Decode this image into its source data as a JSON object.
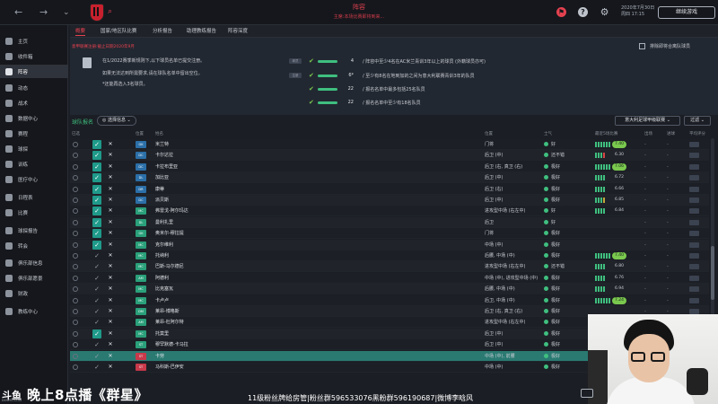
{
  "topbar": {
    "title": "阵容",
    "subtitle": "主席:本场比赛即将到来...",
    "date_line1": "2020年7月30日",
    "date_line2": "周四 17:15",
    "continue_label": "继续游戏"
  },
  "sidebar": {
    "items": [
      {
        "label": "主页"
      },
      {
        "label": "收件箱"
      },
      {
        "label": "阵容"
      },
      {
        "label": "动态"
      },
      {
        "label": "战术"
      },
      {
        "label": "数据中心"
      },
      {
        "label": "赛程"
      },
      {
        "label": "球探"
      },
      {
        "label": "训练"
      },
      {
        "label": "医疗中心"
      },
      {
        "label": "日程表"
      },
      {
        "label": "比赛"
      },
      {
        "label": "球探报告"
      },
      {
        "label": "转会"
      },
      {
        "label": "俱乐部信息"
      },
      {
        "label": "俱乐部愿景"
      },
      {
        "label": "财政"
      },
      {
        "label": "教练中心"
      }
    ],
    "active_index": 2
  },
  "tabs": [
    "概要",
    "国家/地区队比赛",
    "分析报告",
    "助理教练报告",
    "阵容深度"
  ],
  "info": {
    "note": "意甲联赛注册:截止日期2020年9月",
    "desc_lines": [
      "在1/2022赛季新规则下,以下球员名单已提交注册。",
      "如果无法达到所需要求,请在球队名单中留出空位。",
      "*还能再选入3名球员。"
    ],
    "rules": [
      {
        "tag": "球员",
        "check": "✔",
        "value": "4",
        "text": "/ 阵容中至少4名在AC米兰青训3年以上的球员 (外籍球员亦可)"
      },
      {
        "tag": "注册",
        "check": "✔",
        "value": "6*",
        "text": "/ 至少有8名在地到加的之间为意大利联赛青训3年的队员"
      },
      {
        "tag": "",
        "check": "✔",
        "value": "22",
        "text": "/ 报名名单中最多包括25名队员"
      },
      {
        "tag": "",
        "check": "✔",
        "value": "22",
        "text": "/ 报名名单中至少有18名队员"
      }
    ],
    "exclude_label": "排除即将合离队球员"
  },
  "controls": {
    "squad_title": "球队报名",
    "select_label": "◎ 选择信息 ⌄",
    "league_label": "意大利足球甲级联赛 ⌄",
    "filter_label": "过滤 ⌄"
  },
  "headers": {
    "select": "已选",
    "pos": "位置",
    "name": "姓名",
    "position": "位置",
    "morale": "士气",
    "form": "最近5场比赛",
    "rating": "平均评分",
    "apps": "出场",
    "goals": "进球",
    "avg": "平均评分"
  },
  "rows": [
    {
      "c1": true,
      "c2": true,
      "pos": "GK",
      "pos_color": "#2b6fa8",
      "name": "米兰特",
      "position": "门将",
      "morale": "好",
      "rating": "7.40",
      "hi": true,
      "form": "gggggg"
    },
    {
      "c1": true,
      "c2": true,
      "pos": "DC",
      "pos_color": "#2b6fa8",
      "name": "卡尔达拉",
      "position": "后卫 (中)",
      "morale": "还不错",
      "rating": "6.30",
      "hi": false,
      "form": "gggr"
    },
    {
      "c1": true,
      "c2": true,
      "pos": "DC",
      "pos_color": "#2b6fa8",
      "name": "卡拉布里亚",
      "position": "后卫 (右, 真卫 (右)",
      "morale": "极好",
      "rating": "7.06",
      "hi": true,
      "form": "gggggg"
    },
    {
      "c1": true,
      "c2": true,
      "pos": "DL",
      "pos_color": "#2b6fa8",
      "name": "加比亚",
      "position": "后卫 (中)",
      "morale": "极好",
      "rating": "6.72",
      "hi": false,
      "form": "gggg"
    },
    {
      "c1": true,
      "c2": true,
      "pos": "DR",
      "pos_color": "#2b6fa8",
      "name": "康蒂",
      "position": "后卫 (右)",
      "morale": "极好",
      "rating": "6.66",
      "hi": false,
      "form": "gggg"
    },
    {
      "c1": true,
      "c2": true,
      "pos": "DC",
      "pos_color": "#2b6fa8",
      "name": "派贝斯",
      "position": "后卫 (中)",
      "morale": "极好",
      "rating": "6.85",
      "hi": false,
      "form": "gggy"
    },
    {
      "c1": true,
      "c2": true,
      "pos": "MC",
      "pos_color": "#2aa07a",
      "name": "弗雷戈-阿尔玛达",
      "position": "进攻型中场 (右左中)",
      "morale": "好",
      "rating": "6.84",
      "hi": false,
      "form": "gggg"
    },
    {
      "c1": true,
      "c2": true,
      "pos": "DL",
      "pos_color": "#2aa07a",
      "name": "曼利扎里",
      "position": "后卫",
      "morale": "好",
      "rating": "",
      "hi": false,
      "form": ""
    },
    {
      "c1": true,
      "c2": true,
      "pos": "GK",
      "pos_color": "#2aa07a",
      "name": "奥米尔-穆拉提",
      "position": "门将",
      "morale": "极好",
      "rating": "",
      "hi": false,
      "form": ""
    },
    {
      "c1": true,
      "c2": true,
      "pos": "MC",
      "pos_color": "#2aa07a",
      "name": "克尔维利",
      "position": "中场 (中)",
      "morale": "极好",
      "rating": "",
      "hi": false,
      "form": ""
    },
    {
      "c1": false,
      "c2": true,
      "pos": "MC",
      "pos_color": "#2aa07a",
      "name": "托纳利",
      "position": "后腰, 中场 (中)",
      "morale": "极好",
      "rating": "7.40",
      "hi": true,
      "form": "gggggg"
    },
    {
      "c1": false,
      "c2": true,
      "pos": "MC",
      "pos_color": "#2aa07a",
      "name": "巴斯-马尔德尼",
      "position": "进攻型中场 (右左中)",
      "morale": "还不错",
      "rating": "6.80",
      "hi": false,
      "form": "gggg"
    },
    {
      "c1": false,
      "c2": true,
      "pos": "AM",
      "pos_color": "#2aa07a",
      "name": "阿德利",
      "position": "中场 (中), 进攻型中场 (中)",
      "morale": "极好",
      "rating": "6.76",
      "hi": false,
      "form": "gggg"
    },
    {
      "c1": false,
      "c2": true,
      "pos": "MC",
      "pos_color": "#2aa07a",
      "name": "比克塞瓦",
      "position": "后腰, 中场 (中)",
      "morale": "极好",
      "rating": "6.94",
      "hi": false,
      "form": "gggg"
    },
    {
      "c1": false,
      "c2": true,
      "pos": "MC",
      "pos_color": "#2aa07a",
      "name": "卡卢卢",
      "position": "后卫, 中场 (中)",
      "morale": "极好",
      "rating": "7.24",
      "hi": true,
      "form": "gggggg"
    },
    {
      "c1": false,
      "c2": true,
      "pos": "DM",
      "pos_color": "#2aa07a",
      "name": "莱昂-博格斯",
      "position": "后卫 (右, 真卫 (右)",
      "morale": "极好",
      "rating": "",
      "hi": false,
      "form": ""
    },
    {
      "c1": false,
      "c2": true,
      "pos": "AM",
      "pos_color": "#2aa07a",
      "name": "莱昂-杜阿尔特",
      "position": "进攻型中场 (右左中)",
      "morale": "极好",
      "rating": "6.96",
      "hi": false,
      "form": "gggg"
    },
    {
      "c1": true,
      "c2": true,
      "pos": "MC",
      "pos_color": "#2aa07a",
      "name": "托莫里",
      "position": "后卫 (中)",
      "morale": "极好",
      "rating": "6.84",
      "hi": false,
      "form": "gggg"
    },
    {
      "c1": false,
      "c2": true,
      "pos": "ST",
      "pos_color": "#2aa07a",
      "name": "穆罕默德-卡马拉",
      "position": "后卫 (中)",
      "morale": "极好",
      "rating": "",
      "hi": false,
      "form": "gggg"
    },
    {
      "c1": false,
      "c2": true,
      "pos": "ST",
      "pos_color": "#c8394a",
      "name": "卡劳",
      "position": "中场 (中), 前腰",
      "morale": "极好",
      "rating": "",
      "hi": false,
      "form": "",
      "highlight": true
    },
    {
      "c1": false,
      "c2": true,
      "pos": "ST",
      "pos_color": "#c8394a",
      "name": "马科斯-巴伊安",
      "position": "中场 (中)",
      "morale": "极好",
      "rating": "",
      "hi": false,
      "form": ""
    }
  ],
  "overlay": {
    "logo": "斗鱼",
    "stream_title": "晚上8点播《群星》",
    "fan_info": "11级粉丝牌给房管|粉丝群596533076黑粉群596190687|微博李晗风",
    "watermark": "DOUYU.COM"
  }
}
